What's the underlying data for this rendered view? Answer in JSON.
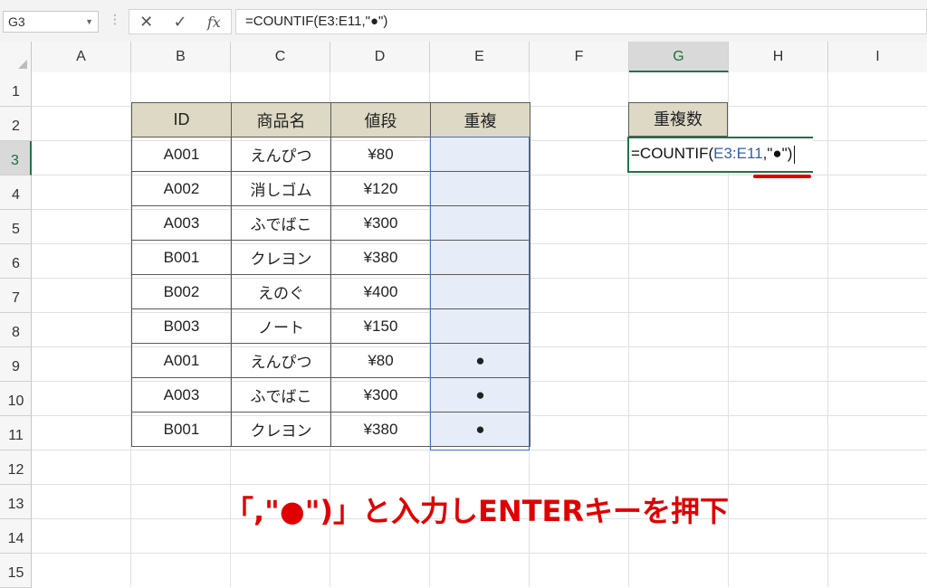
{
  "namebox": {
    "value": "G3"
  },
  "toolbar": {
    "cancel_icon": "✕",
    "enter_icon": "✓",
    "fx_label": "fx"
  },
  "formula_bar": {
    "value": "=COUNTIF(E3:E11,\"●\")"
  },
  "columns": [
    "A",
    "B",
    "C",
    "D",
    "E",
    "F",
    "G",
    "H",
    "I"
  ],
  "selected_column": "G",
  "rows": [
    "1",
    "2",
    "3",
    "4",
    "5",
    "6",
    "7",
    "8",
    "9",
    "10",
    "11",
    "12",
    "13",
    "14",
    "15"
  ],
  "selected_row": "3",
  "table": {
    "headers": [
      "ID",
      "商品名",
      "値段",
      "重複"
    ],
    "rows": [
      [
        "A001",
        "えんぴつ",
        "¥80",
        ""
      ],
      [
        "A002",
        "消しゴム",
        "¥120",
        ""
      ],
      [
        "A003",
        "ふでばこ",
        "¥300",
        ""
      ],
      [
        "B001",
        "クレヨン",
        "¥380",
        ""
      ],
      [
        "B002",
        "えのぐ",
        "¥400",
        ""
      ],
      [
        "B003",
        "ノート",
        "¥150",
        ""
      ],
      [
        "A001",
        "えんぴつ",
        "¥80",
        "●"
      ],
      [
        "A003",
        "ふでばこ",
        "¥300",
        "●"
      ],
      [
        "B001",
        "クレヨン",
        "¥380",
        "●"
      ]
    ]
  },
  "count_header": "重複数",
  "edit_cell": {
    "prefix": "=COUNTIF(",
    "ref": "E3:E11",
    "suffix": ",\"●\")"
  },
  "annotation": "「,\"●\")」と入力しENTERキーを押下",
  "colors": {
    "accent": "#217346",
    "header_fill": "#ddd9c4",
    "dup_fill": "#e6edf8",
    "annotation": "#e00000",
    "ref": "#2f5fad"
  }
}
